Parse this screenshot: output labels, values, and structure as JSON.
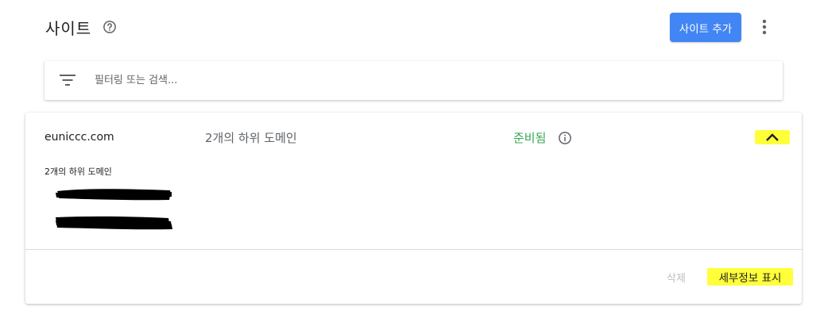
{
  "header": {
    "title": "사이트",
    "add_site_label": "사이트 추가"
  },
  "filter": {
    "placeholder": "필터링 또는 검색..."
  },
  "site": {
    "domain": "euniccc.com",
    "subdomain_count": "2개의 하위 도메인",
    "status": "준비됨",
    "subdomain_heading": "2개의 하위 도메인",
    "delete_label": "삭제",
    "details_label": "세부정보 표시"
  },
  "colors": {
    "accent": "#4285f4",
    "status_ready": "#34a853",
    "highlight": "#ffff3a"
  },
  "icons": {
    "help": "help-circle-icon",
    "more": "more-vert-icon",
    "filter": "filter-list-icon",
    "info": "info-icon",
    "collapse": "chevron-up-icon"
  }
}
